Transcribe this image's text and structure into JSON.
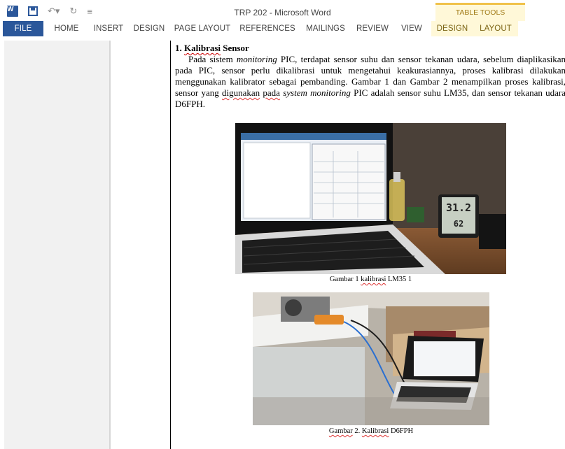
{
  "titlebar": {
    "title": "TRP 202 - Microsoft Word",
    "context_tab_group": "TABLE TOOLS",
    "icons": [
      "word-app-icon",
      "save-icon",
      "undo-icon",
      "redo-icon",
      "customize-qat-icon"
    ]
  },
  "ribbon": {
    "tabs": [
      "FILE",
      "HOME",
      "INSERT",
      "DESIGN",
      "PAGE LAYOUT",
      "REFERENCES",
      "MAILINGS",
      "REVIEW",
      "VIEW"
    ],
    "context_tabs": [
      "DESIGN",
      "LAYOUT"
    ]
  },
  "document": {
    "heading_number": "1.",
    "heading_word1": "Kalibrasi",
    "heading_word2": "Sensor",
    "para_a": "Pada sistem ",
    "para_b": "monitoring",
    "para_c": " PIC, terdapat sensor suhu dan sensor tekanan udara, sebelum diaplikasikan pada PIC, sensor perlu dikalibrasi untuk mengetahui keakurasiannya, proses kalibrasi dilakukan menggunakan kalibrator sebagai pembanding. Gambar 1 dan Gambar 2 menampilkan proses kalibrasi, sensor yang ",
    "para_d": "digunakan",
    "para_e": " ",
    "para_f": "pada",
    "para_g": " ",
    "para_h": "system monitoring",
    "para_i": " PIC adalah sensor suhu LM35, dan sensor tekanan udara D6FPH.",
    "fig1_caption_a": "Gambar 1 ",
    "fig1_caption_b": "kalibrasi",
    "fig1_caption_c": " LM35 1",
    "fig2_caption_a": "Gambar",
    "fig2_caption_b": " 2. ",
    "fig2_caption_c": "Kalibrasi",
    "fig2_caption_d": " D6FPH",
    "fig1_thermometer_readout": "31.2",
    "fig1_hygrometer_readout": "62"
  },
  "colors": {
    "accent": "#2b579a",
    "context_tab_bg": "#fff8d8",
    "context_tab_border": "#f0c24a",
    "spellcheck": "#d33"
  }
}
